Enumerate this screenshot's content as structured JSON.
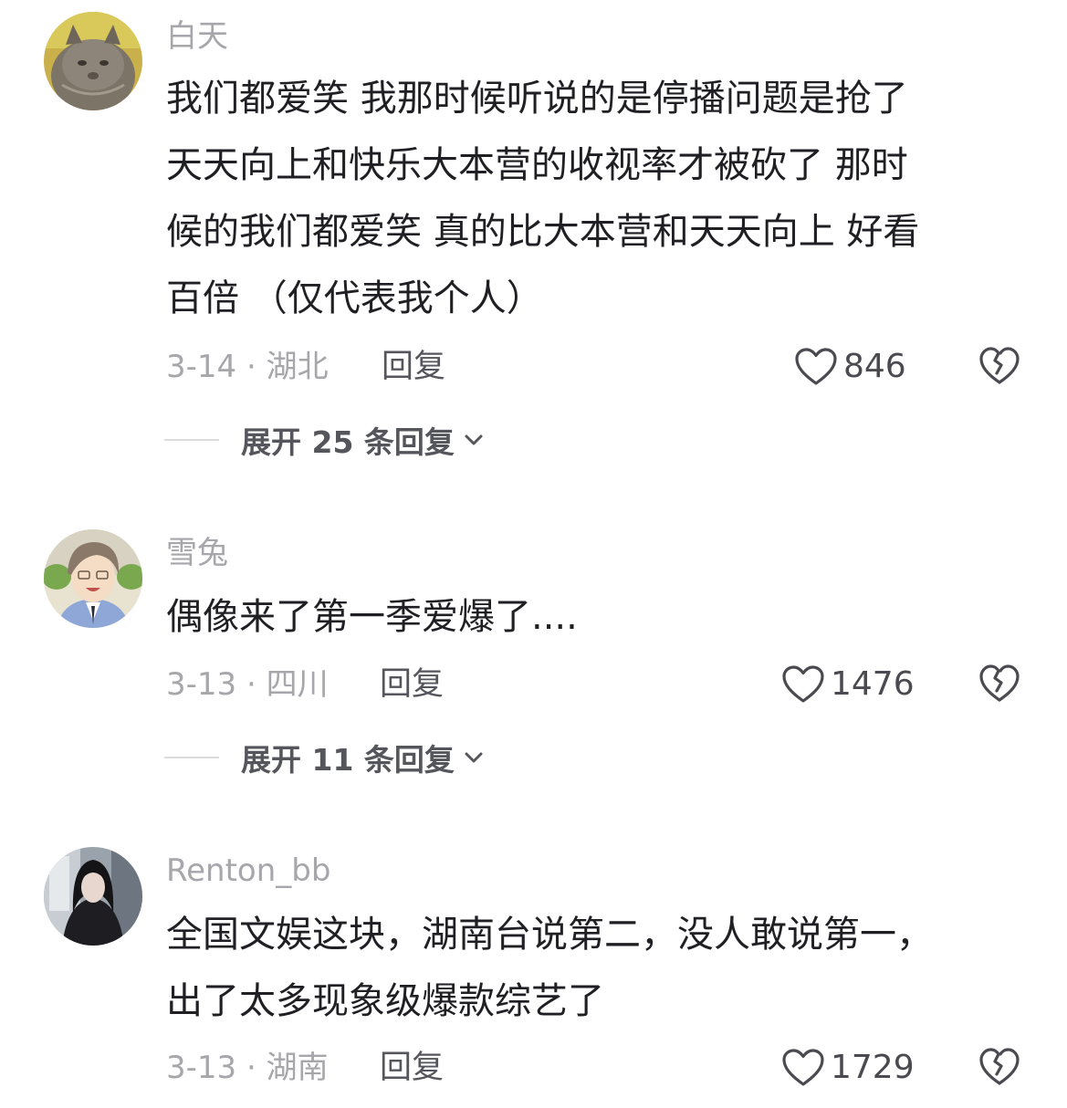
{
  "comments": [
    {
      "username": "白天",
      "lines": [
        "我们都爱笑 我那时候听说的是停播问题是抢了",
        "天天向上和快乐大本营的收视率才被砍了  那时",
        "候的我们都爱笑 真的比大本营和天天向上 好看",
        "百倍 （仅代表我个人）"
      ],
      "date_location": "3-14 · 湖北",
      "reply_label": "回复",
      "likes": "846",
      "expand_label": "展开 25 条回复",
      "avatar_icon": "cat-photo-avatar"
    },
    {
      "username": "雪兔",
      "lines": [
        "偶像来了第一季爱爆了...."
      ],
      "date_location": "3-13 · 四川",
      "reply_label": "回复",
      "likes": "1476",
      "expand_label": "展开 11 条回复",
      "avatar_icon": "anime-character-avatar"
    },
    {
      "username": "Renton_bb",
      "lines": [
        "全国文娱这块，湖南台说第二，没人敢说第一，",
        "出了太多现象级爆款综艺了"
      ],
      "date_location": "3-13 · 湖南",
      "reply_label": "回复",
      "likes": "1729",
      "avatar_icon": "person-photo-avatar"
    }
  ],
  "colors": {
    "text_primary": "#1f1f24",
    "text_secondary": "#a6a6ab",
    "text_action": "#55555c",
    "icon_stroke": "#4a4a50"
  }
}
